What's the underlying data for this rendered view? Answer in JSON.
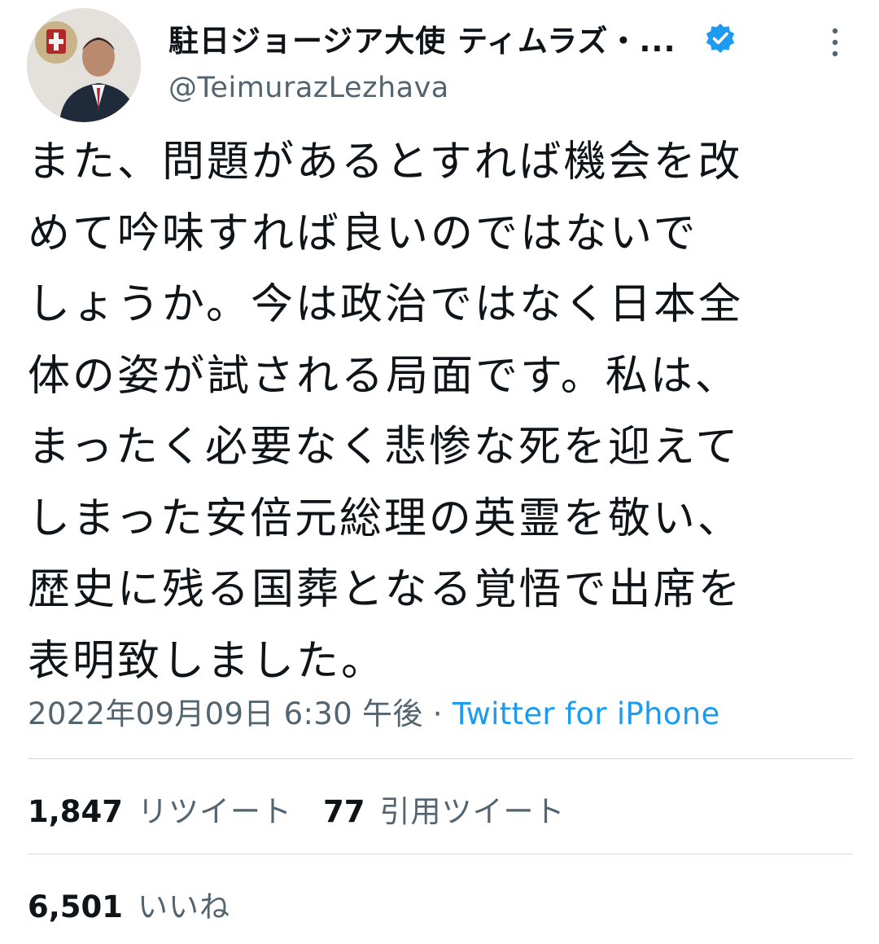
{
  "tweet": {
    "author": {
      "display_name": "駐日ジョージア大使 ティムラズ・...",
      "handle": "@TeimurazLezhava",
      "verified": true
    },
    "text_lines": [
      "また、問題があるとすれば機会を改",
      "めて吟味すれば良いのではないで",
      "しょうか。今は政治ではなく日本全",
      "体の姿が試される局面です。私は、",
      "まったく必要なく悲惨な死を迎えて",
      "しまった安倍元総理の英霊を敬い、",
      "歴史に残る国葬となる覚悟で出席を",
      "表明致しました。"
    ],
    "timestamp": "2022年09月09日 6:30 午後",
    "separator": " · ",
    "source": "Twitter for iPhone"
  },
  "stats": {
    "retweets": {
      "count": "1,847",
      "label": "リツイート"
    },
    "quotes": {
      "count": "77",
      "label": "引用ツイート"
    },
    "likes": {
      "count": "6,501",
      "label": "いいね"
    }
  },
  "colors": {
    "accent": "#1d9bf0",
    "secondary_text": "#536471",
    "primary_text": "#0f1419",
    "divider": "#cfd9de"
  },
  "icons": {
    "verified": "verified-badge-icon",
    "more": "more-vertical-icon"
  }
}
